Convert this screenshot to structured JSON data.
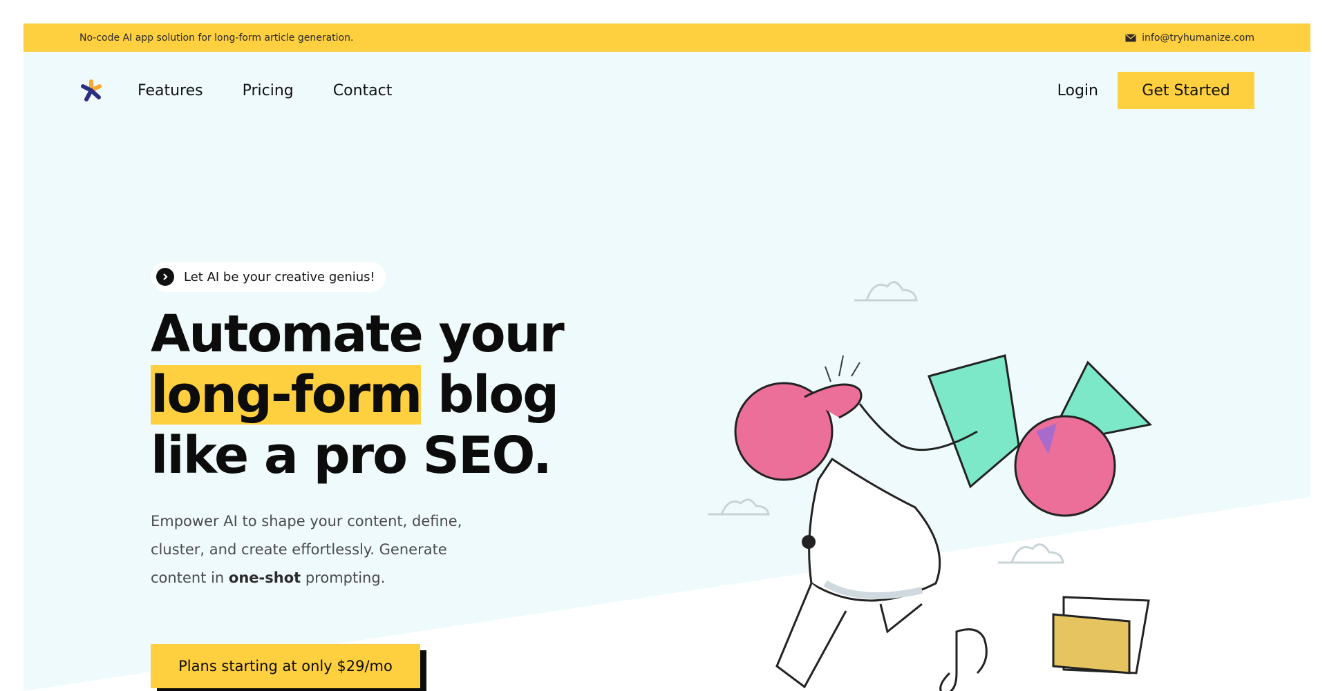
{
  "topbar": {
    "tagline": "No-code AI app solution for long-form article generation.",
    "email": "info@tryhumanize.com",
    "email_icon": "mail-icon"
  },
  "nav": {
    "logo_icon": "asterisk-logo-icon",
    "links": [
      "Features",
      "Pricing",
      "Contact"
    ],
    "login": "Login",
    "cta": "Get Started"
  },
  "hero": {
    "pill_text": "Let AI be your creative genius!",
    "pill_icon": "chevron-right-circle-icon",
    "headline_line1": "Automate your",
    "headline_highlight": "long-form",
    "headline_line2_rest": " blog",
    "headline_line3": "like a pro SEO.",
    "sub_part1": "Empower AI to shape your content, define, cluster, and create effortlessly. Generate content in ",
    "sub_bold": "one-shot",
    "sub_part2": " prompting.",
    "plans_button": "Plans starting at only $29/mo"
  },
  "colors": {
    "accent_yellow": "#fecf3e",
    "hero_bg": "#eefafc",
    "text_dark": "#0c0c0c",
    "illustration_pink": "#ec6f9a",
    "illustration_mint": "#7de8c7",
    "illustration_folder": "#e6c560",
    "logo_navy": "#2b2f80",
    "logo_orange": "#f7a732"
  }
}
